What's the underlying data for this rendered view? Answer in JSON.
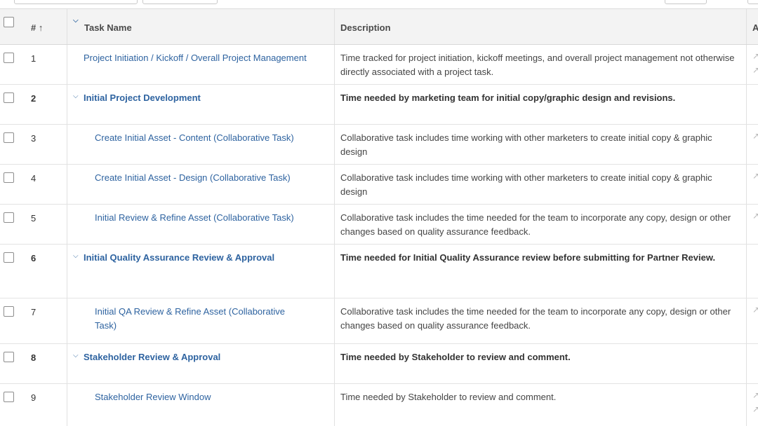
{
  "header": {
    "num_label": "# ↑",
    "task_name_label": "Task Name",
    "description_label": "Description",
    "extra_label": "A"
  },
  "icons": {
    "sort": "up-arrow-icon",
    "collapse": "chevron-down-icon",
    "row_action": "diagonal-arrow-icon"
  },
  "colors": {
    "link": "#2e63a0",
    "header_bg": "#f3f3f3"
  },
  "rows": [
    {
      "num": "1",
      "name": "Project Initiation / Kickoff / Overall Project Management",
      "desc": "Time tracked for project initiation, kickoff meetings, and overall project management not otherwise directly associated with a project task."
    },
    {
      "num": "2",
      "name": "Initial Project Development",
      "desc": "Time needed by marketing team for initial copy/graphic design and revisions."
    },
    {
      "num": "3",
      "name": "Create Initial Asset - Content (Collaborative Task)",
      "desc": "Collaborative task includes time working with other marketers to create initial copy & graphic design"
    },
    {
      "num": "4",
      "name": "Create Initial Asset - Design (Collaborative Task)",
      "desc": "Collaborative task includes time working with other marketers to create initial copy & graphic design"
    },
    {
      "num": "5",
      "name": "Initial Review & Refine Asset (Collaborative Task)",
      "desc": "Collaborative task includes the time needed for the team to incorporate any copy, design or other changes based on quality assurance feedback."
    },
    {
      "num": "6",
      "name": "Initial Quality Assurance Review & Approval",
      "desc": "Time needed for Initial Quality Assurance review before submitting for Partner Review."
    },
    {
      "num": "7",
      "name": "Initial QA Review & Refine Asset (Collaborative Task)",
      "desc": "Collaborative task includes the time needed for the team to incorporate any copy, design or other changes based on quality assurance feedback."
    },
    {
      "num": "8",
      "name": "Stakeholder Review & Approval",
      "desc": "Time needed by Stakeholder to review and comment."
    },
    {
      "num": "9",
      "name": "Stakeholder Review Window",
      "desc": "Time needed by Stakeholder to review and comment."
    }
  ]
}
